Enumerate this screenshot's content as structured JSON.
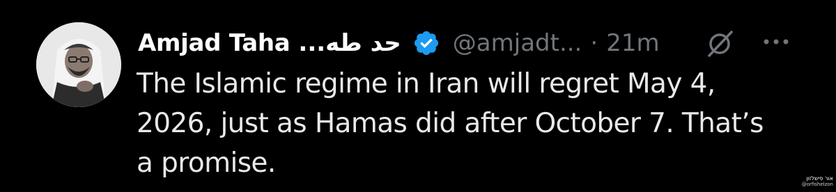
{
  "tweet": {
    "display_name": "Amjad Taha",
    "arabic_name": "...حد طه",
    "handle": "@amjadt...",
    "separator": "·",
    "time_ago": "21m",
    "verified_color": "#1d9bf0",
    "text_lines": [
      "The Islamic regime in Iran will regret May 4,",
      "2026, just as Hamas did after October 7. That’s",
      "a promise."
    ]
  },
  "icons": {
    "verified": "verified-badge-icon",
    "grok": "grok-icon",
    "more": "more-options-icon"
  },
  "watermark": {
    "line1": "אור פישלזון",
    "line2": "@orfishelzon"
  },
  "colors": {
    "background": "#000000",
    "primary_text": "#e7e9ea",
    "secondary_text": "#71767b",
    "name_text": "#ffffff"
  }
}
